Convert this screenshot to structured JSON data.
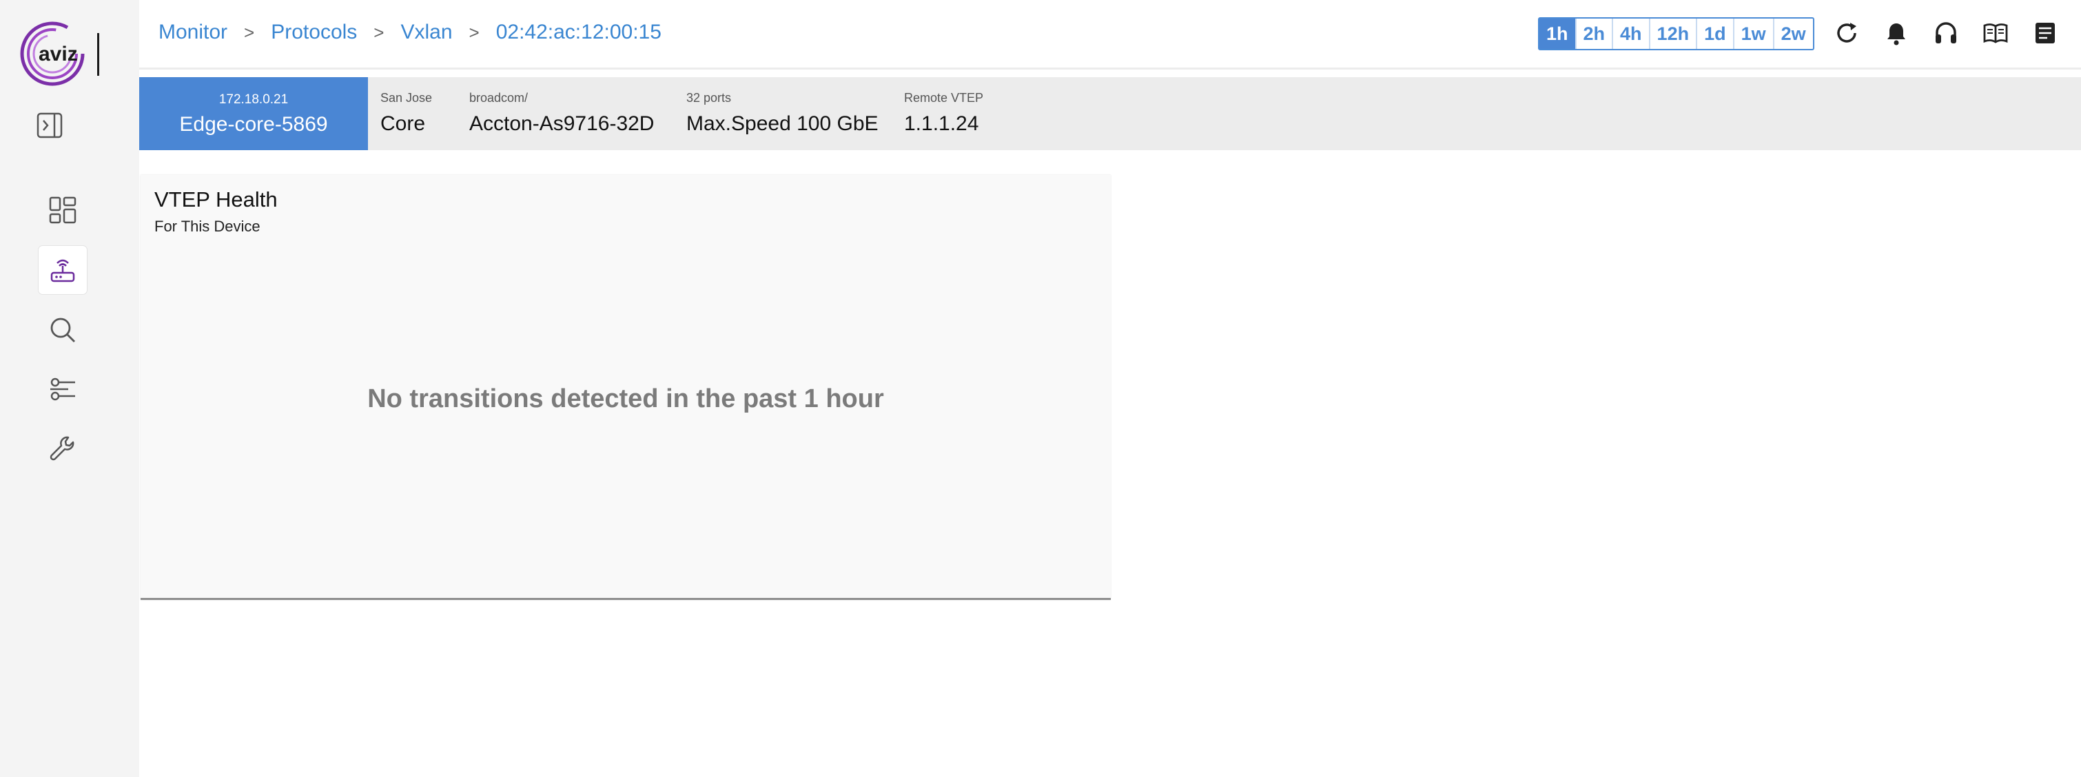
{
  "logo": {
    "text": "aviz"
  },
  "breadcrumb": [
    "Monitor",
    "Protocols",
    "Vxlan",
    "02:42:ac:12:00:15"
  ],
  "breadcrumb_sep": ">",
  "time_range": {
    "options": [
      "1h",
      "2h",
      "4h",
      "12h",
      "1d",
      "1w",
      "2w"
    ],
    "selected": "1h"
  },
  "colors": {
    "accent": "#4a86d4",
    "link": "#3a86d1",
    "logo_purple": "#7b2fa8"
  },
  "sidebar": {
    "items": [
      {
        "icon": "dashboard-icon"
      },
      {
        "icon": "router-icon",
        "active": true
      },
      {
        "icon": "search-icon"
      },
      {
        "icon": "sliders-icon"
      },
      {
        "icon": "wrench-icon"
      }
    ]
  },
  "header_icons": [
    "refresh-icon",
    "bell-icon",
    "headset-icon",
    "book-icon",
    "notes-icon"
  ],
  "device": {
    "ip": "172.18.0.21",
    "name": "Edge-core-5869",
    "location_label": "San Jose",
    "location_value": "Core",
    "vendor_label": "broadcom/",
    "vendor_value": "Accton-As9716-32D",
    "ports_label": "32 ports",
    "ports_value": "Max.Speed 100 GbE",
    "vtep_label": "Remote VTEP",
    "vtep_value": "1.1.1.24"
  },
  "panel": {
    "title": "VTEP Health",
    "subtitle": "For This Device",
    "empty_message": "No transitions detected in the past 1 hour"
  }
}
